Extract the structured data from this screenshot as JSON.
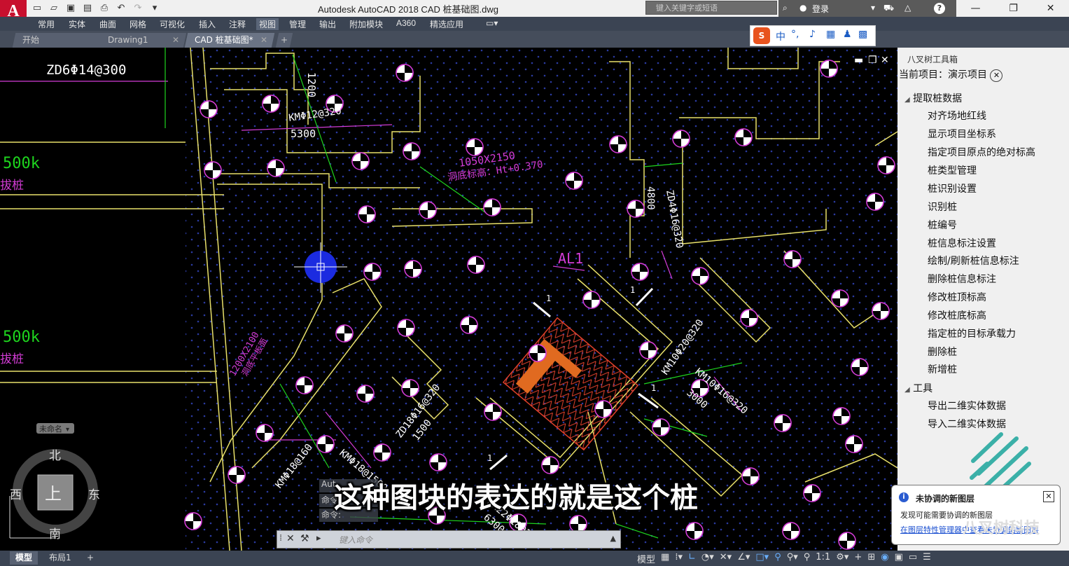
{
  "app": {
    "logo": "A",
    "title": "Autodesk AutoCAD 2018    CAD 桩基础图.dwg",
    "search_placeholder": "键入关键字或短语",
    "login_label": "登录",
    "help_label": "?"
  },
  "ribbon_tabs": [
    "常用",
    "实体",
    "曲面",
    "网格",
    "可视化",
    "插入",
    "注释",
    "视图",
    "管理",
    "输出",
    "附加模块",
    "A360",
    "精选应用"
  ],
  "active_ribbon_tab": "视图",
  "doc_tabs": [
    {
      "label": "开始"
    },
    {
      "label": "Drawing1"
    },
    {
      "label": "CAD 桩基础图*"
    }
  ],
  "drawing": {
    "labels": {
      "zd6": "ZD6Φ14@300",
      "km12": "KMΦ12@320",
      "n5300": "5300",
      "n1200": "1200",
      "n1050": "1050X2150",
      "hole_bottom": "洞底标高：Ht+0.370",
      "n4800": "4800",
      "zd4": "ZD4Φ16@320",
      "al1": "AL1",
      "k500a": "500k",
      "k500b": "500k",
      "pile_a": "拔桩",
      "pile_b": "拔桩",
      "n1200x2100": "1200X2100",
      "hole_flat": "洞底平板面",
      "km20": "KM10Φ20@320",
      "km16": "KM10Φ16@320",
      "n3000": "3000",
      "zd18": "ZD18Φ16@320",
      "n1500": "1500",
      "km18a": "KMΦ18@160",
      "km18b": "KMΦ18@1500",
      "km22": "KM22Φ18@160",
      "n6300": "6300",
      "mark1": "1",
      "mark2": "1",
      "mark3": "1",
      "mark4": "1"
    },
    "viewcube": {
      "unnamed": "未命名",
      "north": "北",
      "south": "南",
      "east": "东",
      "west": "西",
      "top": "上"
    }
  },
  "toolbox": {
    "title": "八叉树工具箱",
    "current_project_label": "当前项目：演示项目",
    "groups": [
      {
        "label": "提取桩数据",
        "items": [
          "对齐场地红线",
          "显示项目坐标系",
          "指定项目原点的绝对标高",
          "桩类型管理",
          "桩识别设置",
          "识别桩",
          "桩编号",
          "桩信息标注设置",
          "绘制/刷新桩信息标注",
          "删除桩信息标注",
          "修改桩顶标高",
          "修改桩底标高",
          "指定桩的目标承载力",
          "删除桩",
          "新增桩"
        ]
      },
      {
        "label": "工具",
        "items": [
          "导出二维实体数据",
          "导入二维实体数据"
        ]
      }
    ]
  },
  "command": {
    "placeholder": "键入命令",
    "history": [
      "Aut",
      "命令:",
      "命令:"
    ]
  },
  "notification": {
    "title": "未协调的新图层",
    "body": "发现可能需要协调的新图层",
    "link": "在图层特性管理器中查看未协调的新图层"
  },
  "status": {
    "layout_tabs": [
      "模型",
      "布局1"
    ],
    "model_label": "模型",
    "scale": "1:1"
  },
  "subtitle": "这种图块的表达的就是这个桩",
  "watermark": "八叉树科技",
  "colors": {
    "background": "#000000",
    "dots": "#2a3aa0",
    "yellow": "#e8e06a",
    "magenta": "#d33cd6",
    "green": "#1ed61e",
    "red": "#e0402a",
    "accent_blue": "#1b2be0"
  }
}
